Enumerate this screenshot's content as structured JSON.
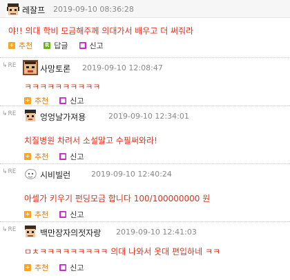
{
  "post": {
    "nickname": "레잘프",
    "datetime": "2019-09-10 08:36:28",
    "text": "야!! 의대 학비 모금해주께 의대가서 배우고 더 써줘라",
    "recommend_label": "추천",
    "reply_label": "답글",
    "report_label": "신고"
  },
  "re_label": "RE",
  "replies": [
    {
      "nickname": "사망토론",
      "datetime": "2019-09-10 12:08:47",
      "text": "ㅋㅋㅋㅋㅋㅋㅋㅋㅋㅋ",
      "recommend_label": "추천",
      "report_label": "신고"
    },
    {
      "nickname": "엉엉날가져용",
      "datetime": "2019-09-10 12:34:01",
      "text": "치질병원 차려서 소설말고 수필써와라!",
      "recommend_label": "추천",
      "report_label": "신고"
    },
    {
      "nickname": "시비빌런",
      "datetime": "2019-09-10 12:40:24",
      "text": "아셀가 키우기 펀딩모금 합니다 100/100000000 원",
      "recommend_label": "추천",
      "report_label": "신고"
    },
    {
      "nickname": "백만장자의젓자랑",
      "datetime": "2019-09-10 12:41:03",
      "text": "ㅁㅊㅋㅋㅋㅋㅋㅋㅋㅋㅋ 의대 나와서 옷대 편입하네 ㅋㅋ",
      "recommend_label": "추천",
      "report_label": "신고"
    }
  ]
}
